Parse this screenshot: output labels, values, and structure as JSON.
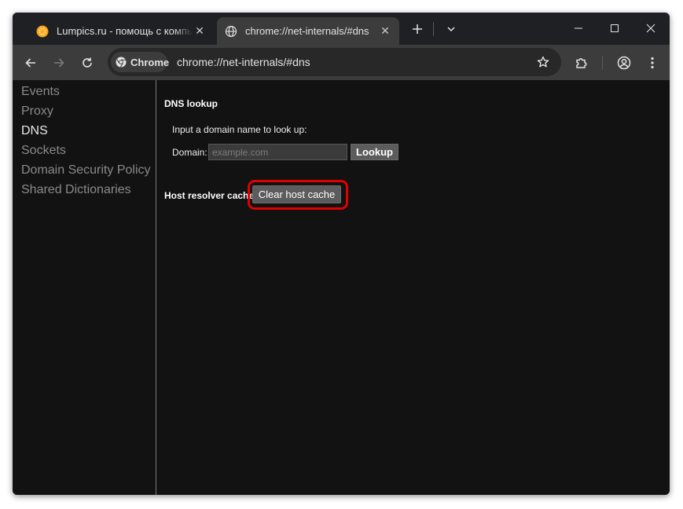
{
  "tabs": [
    {
      "title": "Lumpics.ru - помощь с компьютером",
      "favicon": "orange-slice-icon",
      "active": false
    },
    {
      "title": "chrome://net-internals/#dns",
      "favicon": "globe-icon",
      "active": true
    }
  ],
  "toolbar": {
    "chip_label": "Chrome",
    "url": "chrome://net-internals/#dns"
  },
  "sidebar": {
    "items": [
      {
        "label": "Events"
      },
      {
        "label": "Proxy"
      },
      {
        "label": "DNS",
        "selected": true
      },
      {
        "label": "Sockets"
      },
      {
        "label": "Domain Security Policy"
      },
      {
        "label": "Shared Dictionaries"
      }
    ]
  },
  "dns": {
    "heading": "DNS lookup",
    "instruction": "Input a domain name to look up:",
    "domain_label": "Domain:",
    "domain_placeholder": "example.com",
    "domain_value": "",
    "lookup_label": "Lookup",
    "cache_label": "Host resolver cache",
    "clear_label": "Clear host cache"
  },
  "colors": {
    "highlight": "#e10000",
    "content_bg": "#121212",
    "toolbar_bg": "#3c3c3c"
  }
}
